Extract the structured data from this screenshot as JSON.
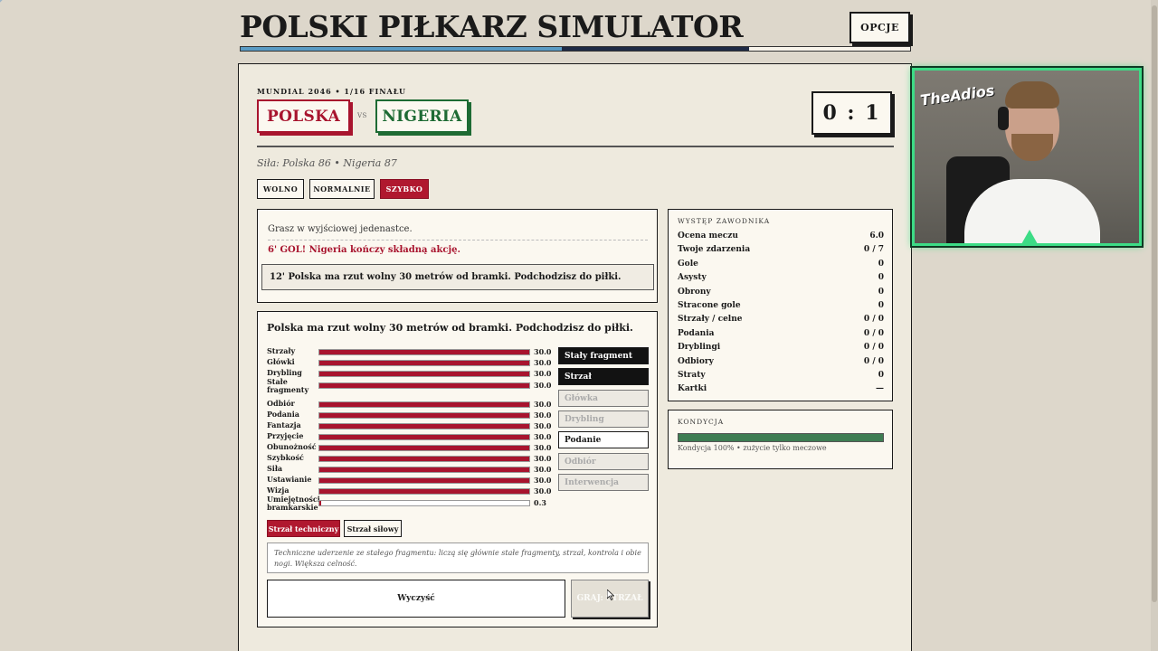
{
  "app": {
    "title": "POLSKI PIŁKARZ SIMULATOR",
    "options_label": "OPCJE"
  },
  "match": {
    "meta": "MUNDIAL 2046 • 1/16 FINAŁU",
    "home_team": "POLSKA",
    "vs": "VS",
    "away_team": "NIGERIA",
    "score": "0 : 1",
    "strength": "Siła: Polska 86 • Nigeria 87",
    "colors": {
      "home": "#a8142e",
      "away": "#1e6b34"
    }
  },
  "speed": {
    "options": [
      "WOLNO",
      "NORMALNIE",
      "SZYBKO"
    ],
    "selected": "SZYBKO"
  },
  "log": {
    "entries": [
      "Grasz w wyjściowej jedenastce.",
      "6' GOL! Nigeria kończy składną akcję."
    ],
    "current": "12' Polska ma rzut wolny 30 metrów od bramki. Podchodzisz do piłki."
  },
  "action": {
    "title": "Polska ma rzut wolny 30 metrów od bramki. Podchodzisz do piłki.",
    "attributes": [
      {
        "label": "Strzały",
        "value": "30.0",
        "level": 1.0
      },
      {
        "label": "Główki",
        "value": "30.0",
        "level": 1.0
      },
      {
        "label": "Drybling",
        "value": "30.0",
        "level": 1.0
      },
      {
        "label": "Stałe fragmenty",
        "value": "30.0",
        "level": 1.0
      },
      {
        "label": "Odbiór",
        "value": "30.0",
        "level": 1.0
      },
      {
        "label": "Podania",
        "value": "30.0",
        "level": 1.0
      },
      {
        "label": "Fantazja",
        "value": "30.0",
        "level": 1.0
      },
      {
        "label": "Przyjęcie",
        "value": "30.0",
        "level": 1.0
      },
      {
        "label": "Obunożność",
        "value": "30.0",
        "level": 1.0
      },
      {
        "label": "Szybkość",
        "value": "30.0",
        "level": 1.0
      },
      {
        "label": "Siła",
        "value": "30.0",
        "level": 1.0
      },
      {
        "label": "Ustawianie",
        "value": "30.0",
        "level": 1.0
      },
      {
        "label": "Wizja",
        "value": "30.0",
        "level": 1.0
      },
      {
        "label": "Umiejętności bramkarskie",
        "value": "0.3",
        "level": 0.01
      }
    ],
    "options": [
      {
        "label": "Stały fragment",
        "state": "selected"
      },
      {
        "label": "Strzał",
        "state": "selected"
      },
      {
        "label": "Główka",
        "state": "disabled"
      },
      {
        "label": "Drybling",
        "state": "disabled"
      },
      {
        "label": "Podanie",
        "state": "enabled"
      },
      {
        "label": "Odbiór",
        "state": "disabled"
      },
      {
        "label": "Interwencja",
        "state": "disabled"
      }
    ],
    "shot_types": [
      "Strzał techniczny",
      "Strzał siłowy"
    ],
    "shot_selected": "Strzał techniczny",
    "description": "Techniczne uderzenie ze stałego fragmentu: liczą się głównie stałe fragmenty, strzał, kontrola i obie nogi. Większa celność.",
    "clear_label": "Wyczyść",
    "play_label": "GRAJ: STRZAŁ"
  },
  "stats": {
    "heading": "WYSTĘP ZAWODNIKA",
    "rows": [
      {
        "label": "Ocena meczu",
        "value": "6.0"
      },
      {
        "label": "Twoje zdarzenia",
        "value": "0 / 7"
      },
      {
        "label": "Gole",
        "value": "0"
      },
      {
        "label": "Asysty",
        "value": "0"
      },
      {
        "label": "Obrony",
        "value": "0"
      },
      {
        "label": "Stracone gole",
        "value": "0"
      },
      {
        "label": "Strzały / celne",
        "value": "0 / 0"
      },
      {
        "label": "Podania",
        "value": "0 / 0"
      },
      {
        "label": "Dryblingi",
        "value": "0 / 0"
      },
      {
        "label": "Odbiory",
        "value": "0 / 0"
      },
      {
        "label": "Straty",
        "value": "0"
      },
      {
        "label": "Kartki",
        "value": "—"
      }
    ]
  },
  "condition": {
    "heading": "KONDYCJA",
    "level": 1.0,
    "text": "Kondycja 100% • zużycie tylko meczowe"
  },
  "webcam": {
    "logo": "TheAdios"
  }
}
